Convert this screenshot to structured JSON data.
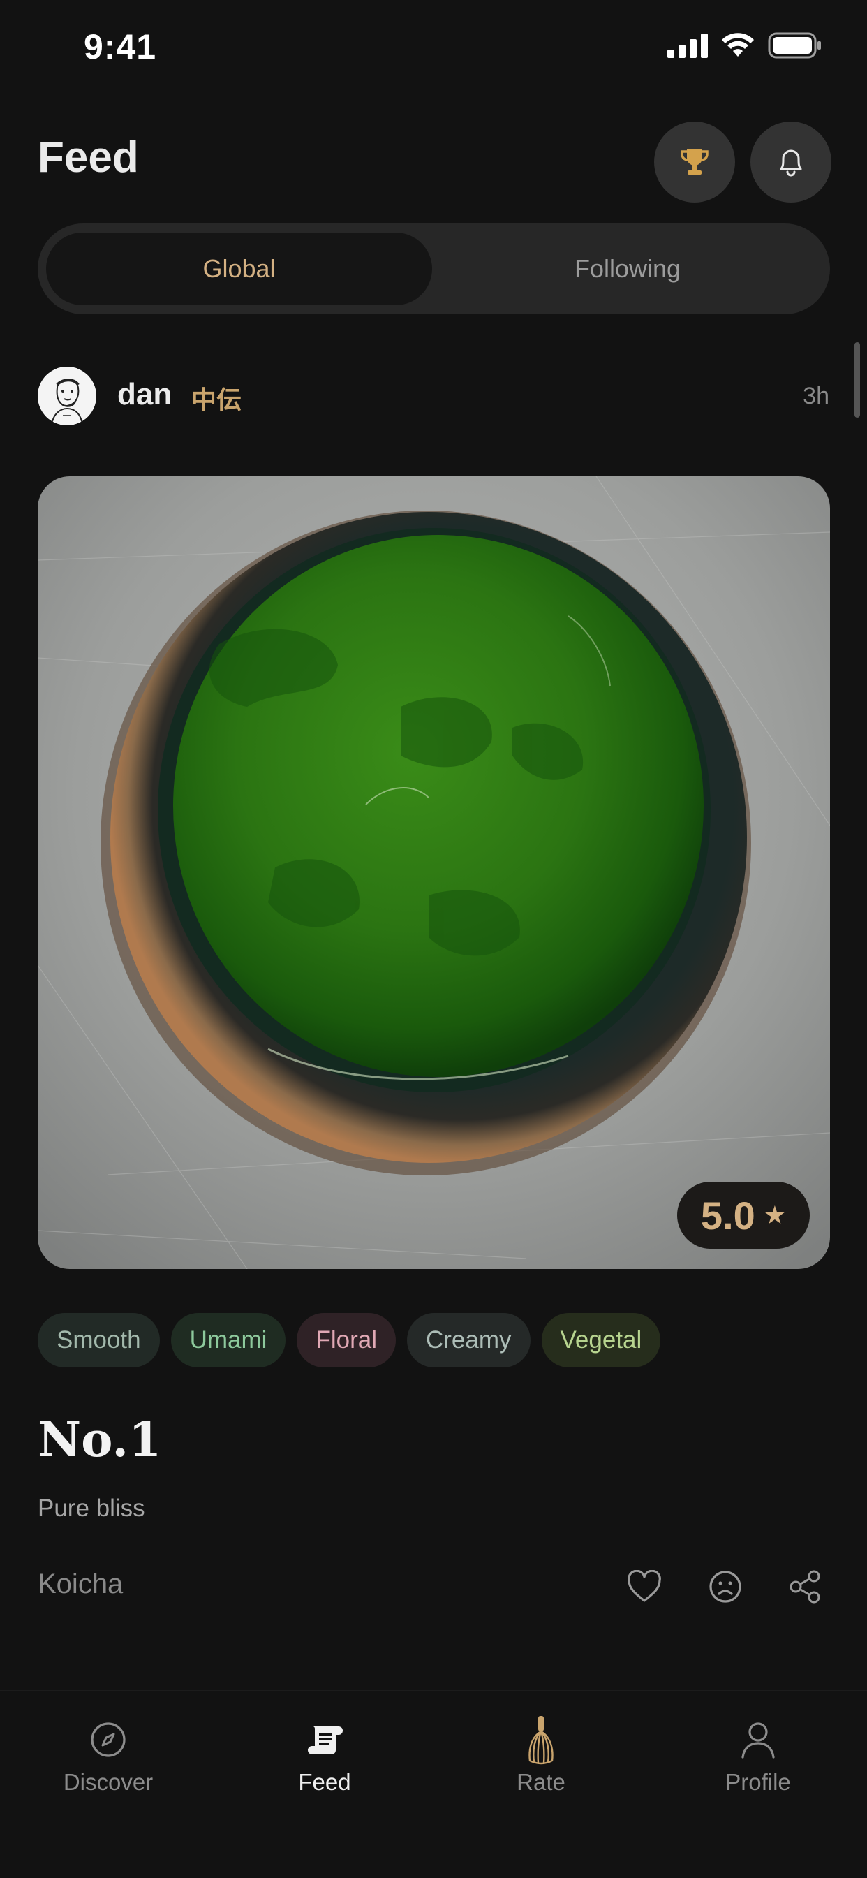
{
  "status_bar": {
    "time": "9:41"
  },
  "header": {
    "title": "Feed",
    "trophy_icon": "trophy-icon",
    "bell_icon": "bell-icon"
  },
  "segmented": {
    "tabs": [
      "Global",
      "Following"
    ],
    "selected": "Global"
  },
  "post": {
    "username": "dan",
    "rank": "中伝",
    "time_ago": "3h",
    "rating": "5.0",
    "tags": [
      {
        "label": "Smooth",
        "bg": "#222a26",
        "fg": "#a3b9ac"
      },
      {
        "label": "Umami",
        "bg": "#1f2c22",
        "fg": "#8dc99c"
      },
      {
        "label": "Floral",
        "bg": "#2f2226",
        "fg": "#e0a8b4"
      },
      {
        "label": "Creamy",
        "bg": "#252928",
        "fg": "#adbdb7"
      },
      {
        "label": "Vegetal",
        "bg": "#262d1c",
        "fg": "#b7d48f"
      }
    ],
    "title": "No.1",
    "description": "Pure bliss",
    "type": "Koicha",
    "actions": [
      "heart-icon",
      "frown-icon",
      "share-icon"
    ]
  },
  "tabbar": {
    "items": [
      {
        "label": "Discover",
        "icon": "compass-icon"
      },
      {
        "label": "Feed",
        "icon": "scroll-icon"
      },
      {
        "label": "Rate",
        "icon": "whisk-icon"
      },
      {
        "label": "Profile",
        "icon": "person-icon"
      }
    ],
    "active": "Feed"
  },
  "colors": {
    "background": "#121212",
    "accent": "#d4b183",
    "rank": "#c9a46d"
  }
}
